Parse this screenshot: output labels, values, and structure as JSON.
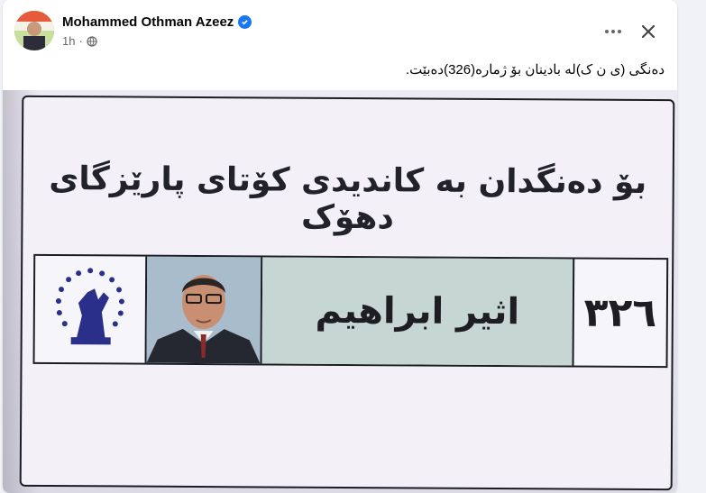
{
  "post": {
    "author_name": "Mohammed Othman Azeez",
    "time": "1h",
    "separator": "·",
    "text": "دەنگی (ی ن ک)لە بادینان بۆ ژمارە(326)دەبێت."
  },
  "icons": {
    "verified": "verified-badge-icon",
    "privacy": "globe-icon",
    "more": "more-options-icon",
    "close": "close-icon"
  },
  "ballot": {
    "title": "بۆ دەنگدان بە کاندیدی کۆتای پارێزگای دهۆک",
    "candidate_name": "اثیر ابراهیم",
    "candidate_number": "٣٢٦"
  },
  "colors": {
    "accent": "#1877f2",
    "logo_blue": "#2a2f8a"
  }
}
